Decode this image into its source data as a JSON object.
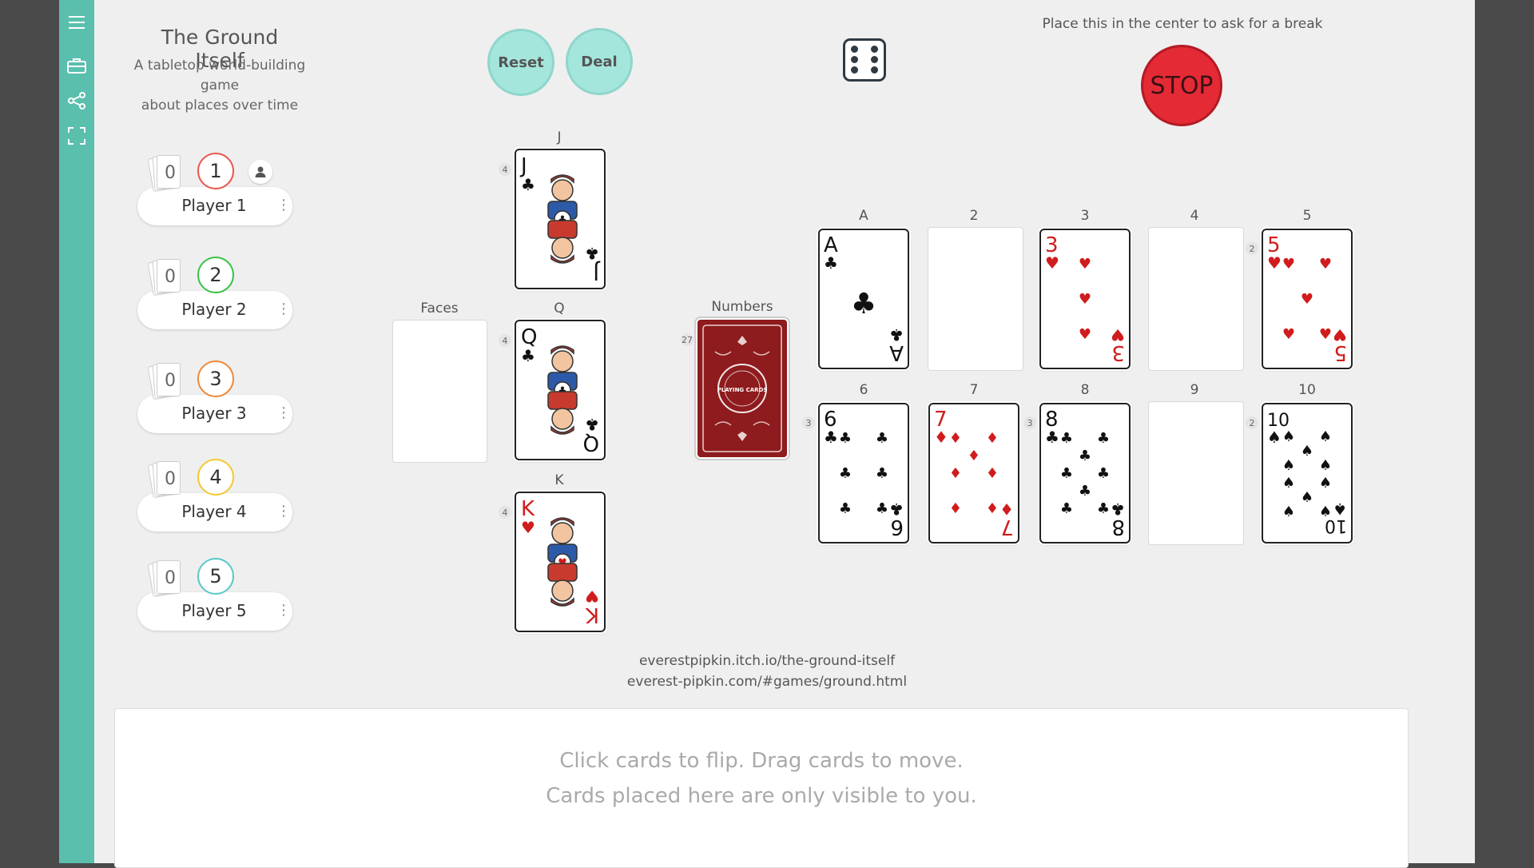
{
  "sidebar": {
    "items": [
      {
        "icon": "menu-icon"
      },
      {
        "icon": "toolbox-icon"
      },
      {
        "icon": "share-icon"
      },
      {
        "icon": "fullscreen-icon"
      }
    ]
  },
  "header": {
    "title": "The Ground Itself",
    "subtitle_line1": "A tabletop world-building game",
    "subtitle_line2": "about places over time"
  },
  "controls": {
    "reset_label": "Reset",
    "deal_label": "Deal",
    "die_value": 6,
    "stop_hint": "Place this in the center to ask for a break",
    "stop_label": "STOP"
  },
  "players": [
    {
      "name": "Player 1",
      "number": "1",
      "cards": "0",
      "color": "#e8584f"
    },
    {
      "name": "Player 2",
      "number": "2",
      "cards": "0",
      "color": "#3cc24a"
    },
    {
      "name": "Player 3",
      "number": "3",
      "cards": "0",
      "color": "#ee8a3c"
    },
    {
      "name": "Player 4",
      "number": "4",
      "cards": "0",
      "color": "#f2c933"
    },
    {
      "name": "Player 5",
      "number": "5",
      "cards": "0",
      "color": "#5cc8c8"
    }
  ],
  "faces": {
    "label": "Faces",
    "piles": [
      {
        "label": "J",
        "count": "4",
        "rank": "J",
        "suit": "♣",
        "color": "#111"
      },
      {
        "label": "Q",
        "count": "4",
        "rank": "Q",
        "suit": "♣",
        "color": "#111"
      },
      {
        "label": "K",
        "count": "4",
        "rank": "K",
        "suit": "♥",
        "color": "#d01c1c"
      }
    ]
  },
  "numbers_deck": {
    "label": "Numbers",
    "count": "27",
    "back_text": "PLAYING CARDS"
  },
  "number_slots": [
    {
      "label": "A",
      "count": "",
      "card": {
        "rank": "A",
        "suit": "♣",
        "color": "#111"
      }
    },
    {
      "label": "2",
      "count": "",
      "card": null
    },
    {
      "label": "3",
      "count": "",
      "card": {
        "rank": "3",
        "suit": "♥",
        "color": "#d01c1c"
      }
    },
    {
      "label": "4",
      "count": "",
      "card": null
    },
    {
      "label": "5",
      "count": "2",
      "card": {
        "rank": "5",
        "suit": "♥",
        "color": "#d01c1c"
      }
    },
    {
      "label": "6",
      "count": "3",
      "card": {
        "rank": "6",
        "suit": "♣",
        "color": "#111"
      }
    },
    {
      "label": "7",
      "count": "",
      "card": {
        "rank": "7",
        "suit": "♦",
        "color": "#d01c1c"
      }
    },
    {
      "label": "8",
      "count": "3",
      "card": {
        "rank": "8",
        "suit": "♣",
        "color": "#111"
      }
    },
    {
      "label": "9",
      "count": "",
      "card": null
    },
    {
      "label": "10",
      "count": "2",
      "card": {
        "rank": "10",
        "suit": "♠",
        "color": "#111"
      }
    }
  ],
  "links": {
    "line1": "everestpipkin.itch.io/the-ground-itself",
    "line2": "everest-pipkin.com/#games/ground.html"
  },
  "hand": {
    "line1": "Click cards to flip.    Drag cards to move.",
    "line2": "Cards placed here are only visible to you."
  }
}
